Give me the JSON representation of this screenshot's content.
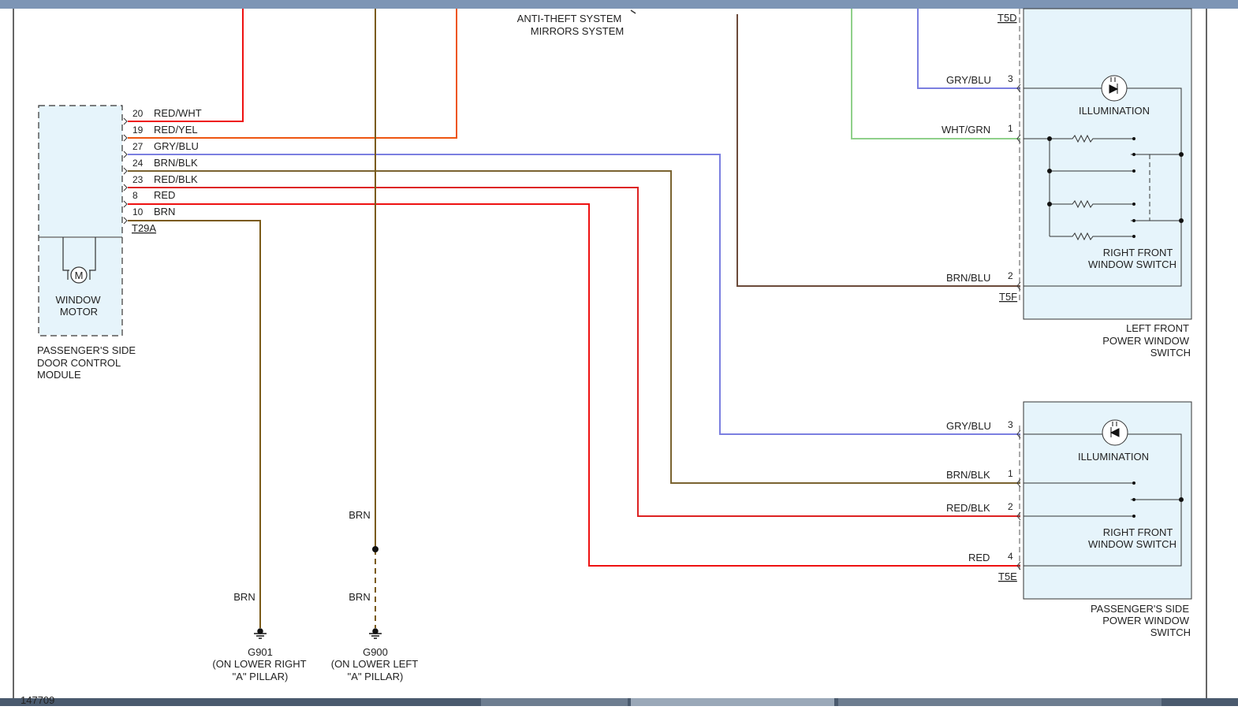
{
  "external_refs": [
    "ANTI-THEFT SYSTEM",
    "MIRRORS SYSTEM"
  ],
  "dcm": {
    "connector": "T29A",
    "pins": [
      {
        "num": "20",
        "wire": "RED/WHT",
        "color": "#ee2222"
      },
      {
        "num": "19",
        "wire": "RED/YEL",
        "color": "#ee5511"
      },
      {
        "num": "27",
        "wire": "GRY/BLU",
        "color": "#7b7fe0"
      },
      {
        "num": "24",
        "wire": "BRN/BLK",
        "color": "#7a6330"
      },
      {
        "num": "23",
        "wire": "RED/BLK",
        "color": "#dd2222"
      },
      {
        "num": "8",
        "wire": "RED",
        "color": "#ee1111"
      },
      {
        "num": "10",
        "wire": "BRN",
        "color": "#7a5a18"
      }
    ],
    "motor_symbol": "M",
    "motor_label": [
      "WINDOW",
      "MOTOR"
    ],
    "module_label": [
      "PASSENGER'S SIDE",
      "DOOR CONTROL",
      "MODULE"
    ]
  },
  "left_switch": {
    "connector_top": "T5D",
    "connector_bottom": "T5F",
    "pins": [
      {
        "num": "3",
        "wire": "GRY/BLU"
      },
      {
        "num": "1",
        "wire": "WHT/GRN"
      },
      {
        "num": "2",
        "wire": "BRN/BLU"
      }
    ],
    "illumination": "ILLUMINATION",
    "inner_label": [
      "RIGHT FRONT",
      "WINDOW SWITCH"
    ],
    "label": [
      "LEFT FRONT",
      "POWER WINDOW",
      "SWITCH"
    ]
  },
  "pass_switch": {
    "connector": "T5E",
    "pins": [
      {
        "num": "3",
        "wire": "GRY/BLU"
      },
      {
        "num": "1",
        "wire": "BRN/BLK"
      },
      {
        "num": "2",
        "wire": "RED/BLK"
      },
      {
        "num": "4",
        "wire": "RED"
      }
    ],
    "illumination": "ILLUMINATION",
    "inner_label": [
      "RIGHT FRONT",
      "WINDOW SWITCH"
    ],
    "label": [
      "PASSENGER'S SIDE",
      "POWER WINDOW",
      "SWITCH"
    ]
  },
  "grounds": [
    {
      "wire": "BRN",
      "name": "G901",
      "location": [
        "(ON LOWER RIGHT",
        "\"A\" PILLAR)"
      ]
    },
    {
      "wire": "BRN",
      "wire_upper": "BRN",
      "name": "G900",
      "location": [
        "(ON LOWER LEFT",
        "\"A\" PILLAR)"
      ]
    }
  ],
  "footer_code": "147709",
  "colors": {
    "red": "#ee1111",
    "orange": "#ee5511",
    "gry_blu": "#7b7fe0",
    "brn": "#7a5a18",
    "brn_blk": "#7a6330",
    "wht_grn": "#8fd08a",
    "brn_blu": "#6b4a3a",
    "module_fill": "#e6f4fb",
    "header_bar": "#7d95b5"
  }
}
